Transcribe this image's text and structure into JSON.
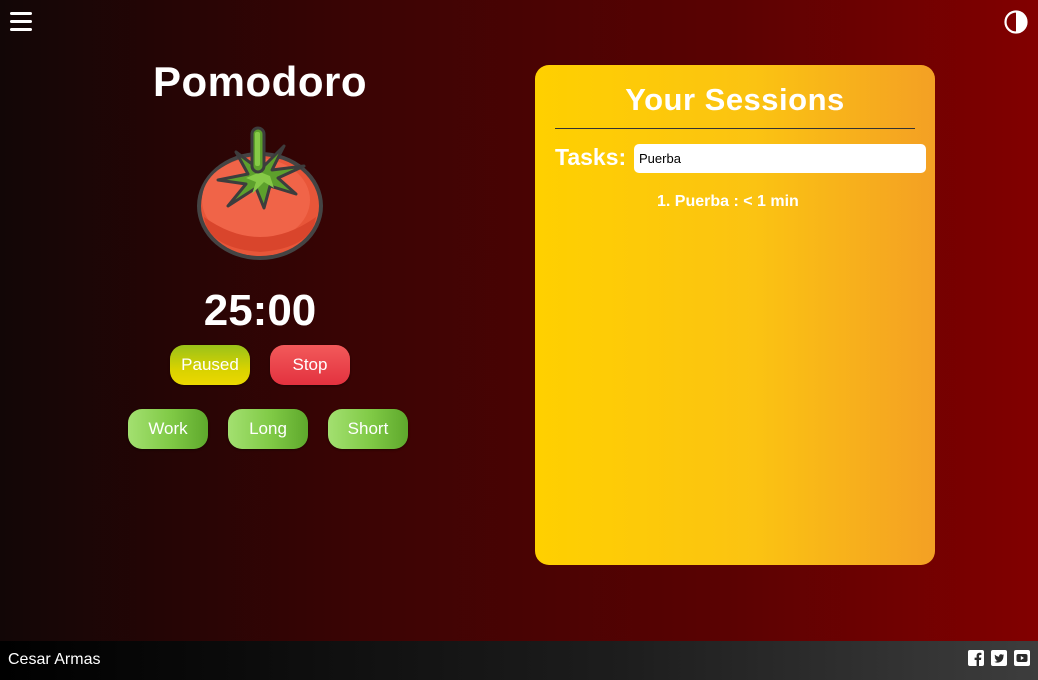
{
  "app": {
    "title": "Pomodoro",
    "timer": "25:00"
  },
  "icons": {
    "menu": "hamburger-menu-icon",
    "theme": "contrast-toggle-icon",
    "tomato": "tomato-icon",
    "facebook": "facebook-icon",
    "twitter": "twitter-icon",
    "youtube": "youtube-icon"
  },
  "controls": {
    "pause_label": "Paused",
    "stop_label": "Stop"
  },
  "modes": {
    "work_label": "Work",
    "long_label": "Long",
    "short_label": "Short"
  },
  "sessions": {
    "title": "Your Sessions",
    "tasks_label": "Tasks:",
    "task_input_value": "Puerba",
    "items": [
      "1. Puerba : < 1 min"
    ]
  },
  "footer": {
    "author": "Cesar Armas"
  },
  "colors": {
    "panel_accent": "#ffd000",
    "stop": "#e3323f",
    "mode_green": "#7fc945",
    "paused_yellow": "#d8d200"
  }
}
